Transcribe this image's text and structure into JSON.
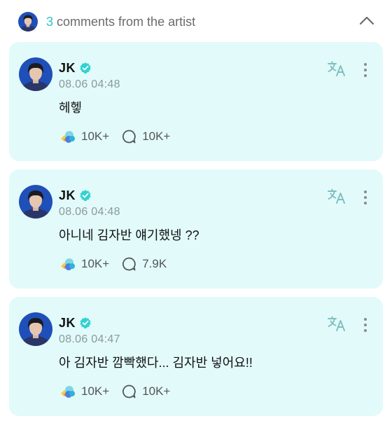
{
  "header": {
    "count": "3",
    "label": "comments from the artist"
  },
  "comments": [
    {
      "author": "JK",
      "time": "08.06 04:48",
      "text": "헤헿",
      "likes": "10K+",
      "replies": "10K+"
    },
    {
      "author": "JK",
      "time": "08.06 04:48",
      "text": "아니네 김자반 얘기했넹 ??",
      "likes": "10K+",
      "replies": "7.9K"
    },
    {
      "author": "JK",
      "time": "08.06 04:47",
      "text": "아 김자반 깜빡했다... 김자반 넣어요!!",
      "likes": "10K+",
      "replies": "10K+"
    }
  ],
  "icons": {
    "collapse": "chevron-up-icon",
    "verified": "verified-badge-icon",
    "translate": "translate-icon",
    "more": "more-vertical-icon",
    "like": "weverse-like-icon",
    "reply": "reply-bubble-icon"
  },
  "colors": {
    "accent": "#2dc3c6",
    "card_background": "#e2fafa",
    "verified": "#32d2cf",
    "translate_icon": "#7fbfbe"
  }
}
